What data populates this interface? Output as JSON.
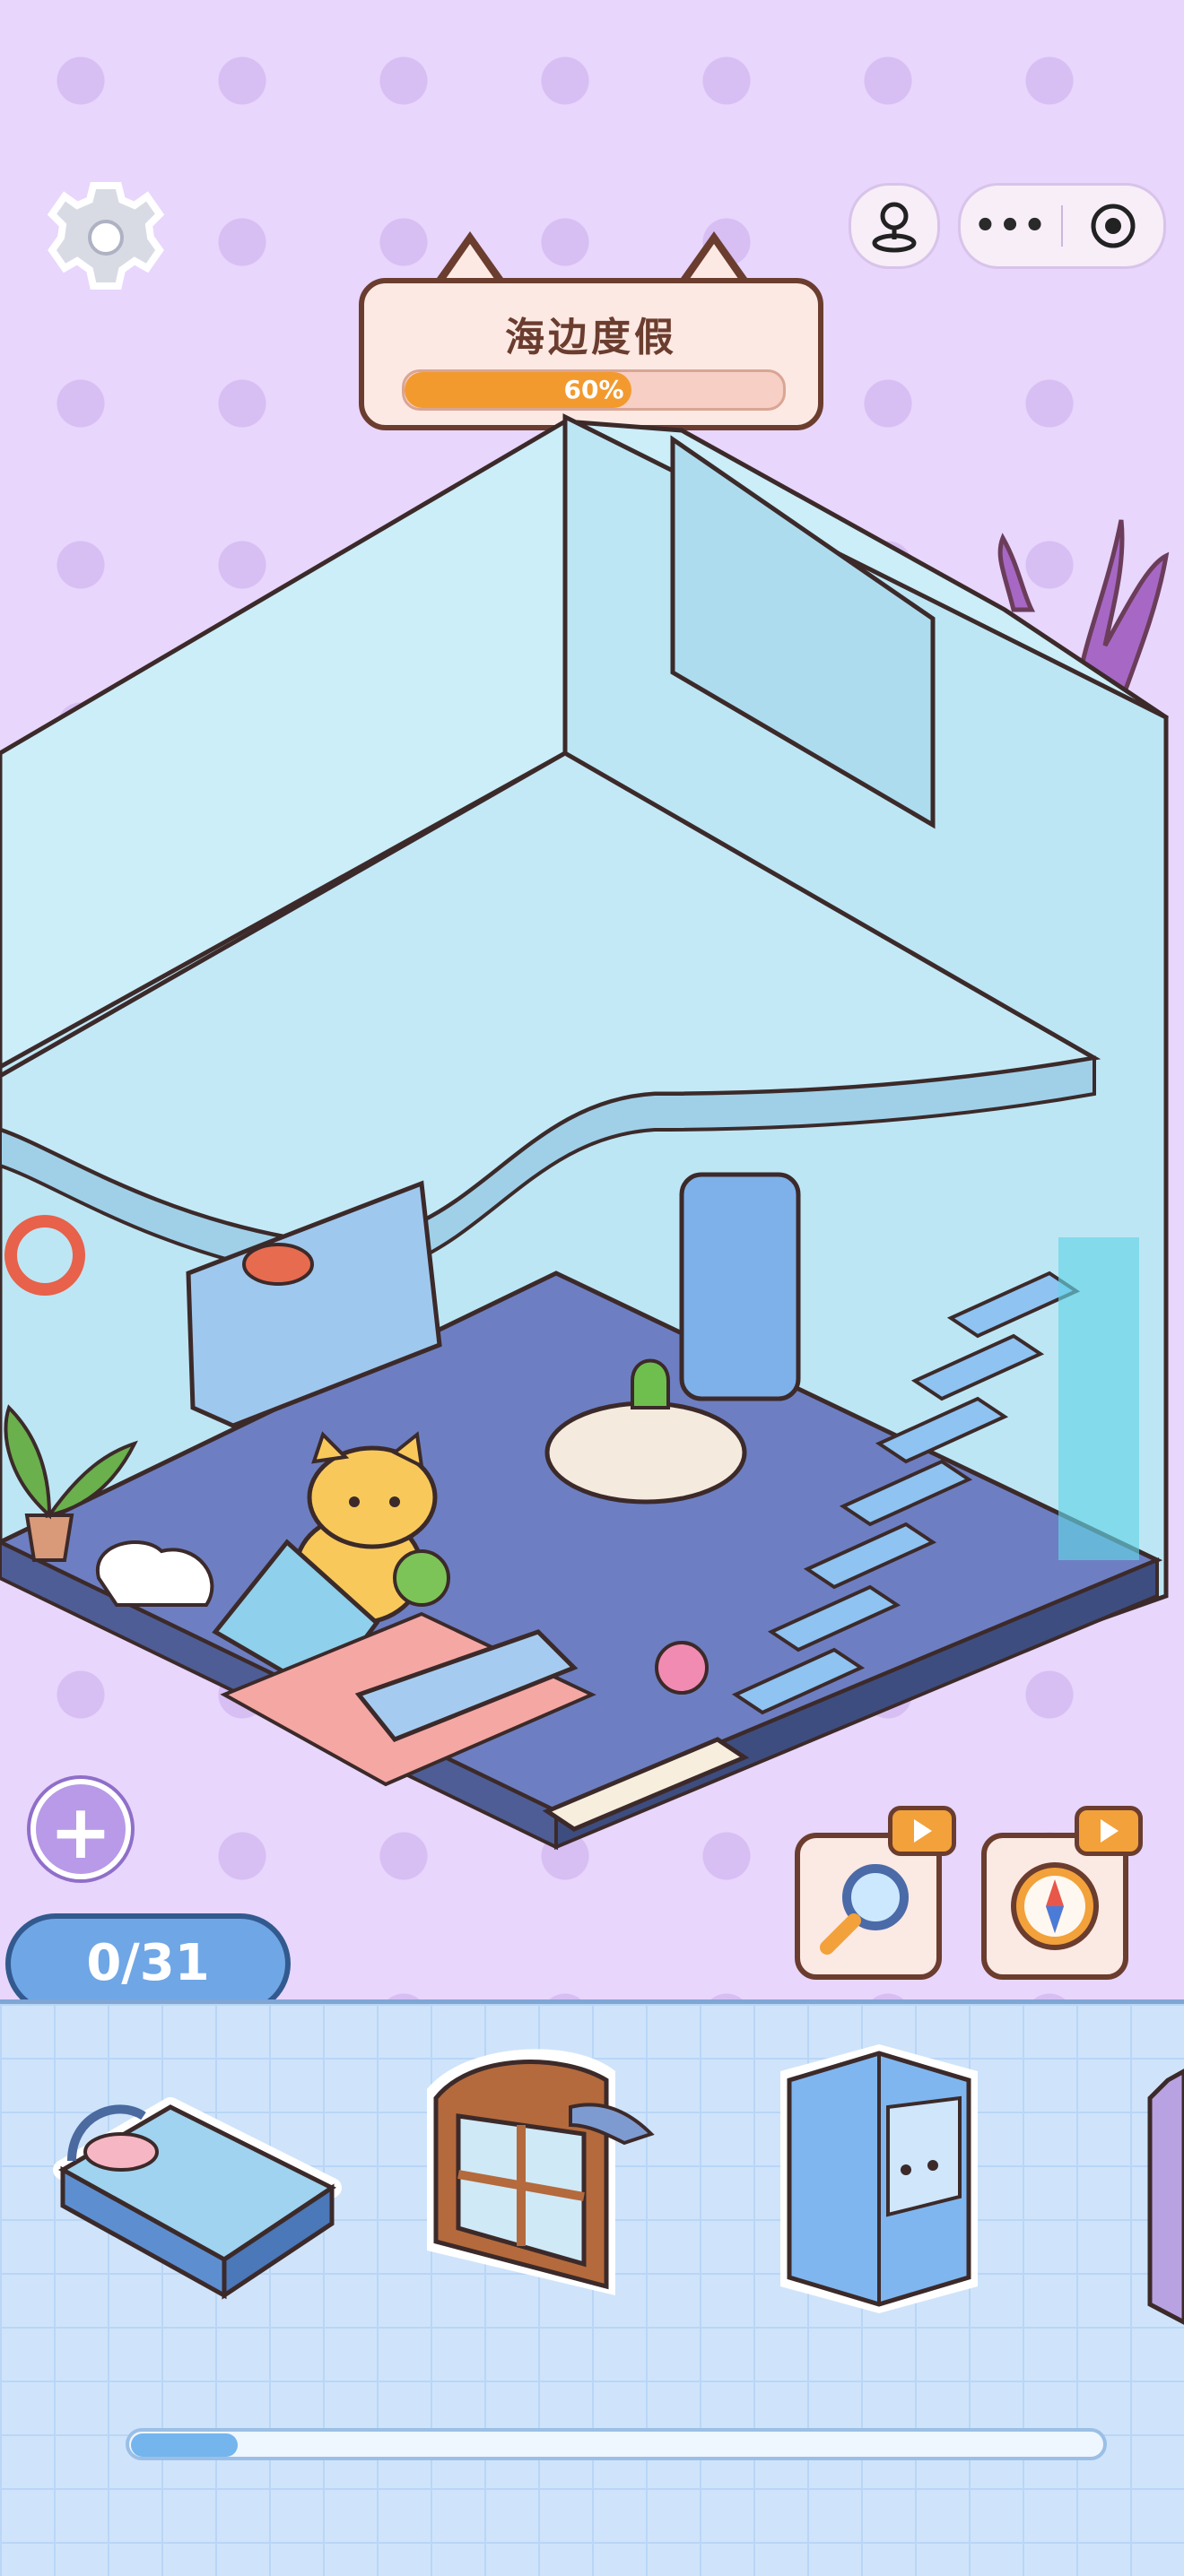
{
  "level": {
    "title": "海边度假",
    "progress_label": "60%",
    "progress": 0.6
  },
  "inventory": {
    "count_label": "0/31",
    "scroll_fraction": 0.11
  },
  "items": [
    {
      "name": "ocean-bed"
    },
    {
      "name": "shark-arched-window"
    },
    {
      "name": "blue-wardrobe"
    }
  ],
  "colors": {
    "accent": "#f39a2f",
    "frame": "#6b3d2f",
    "background": "#e8d6fc",
    "tray": "#cfe4fb"
  },
  "icons": [
    "gear-icon",
    "pin-icon",
    "more-icon",
    "target-icon",
    "plus-icon",
    "magnifier-icon",
    "compass-icon",
    "video-ad-icon"
  ]
}
